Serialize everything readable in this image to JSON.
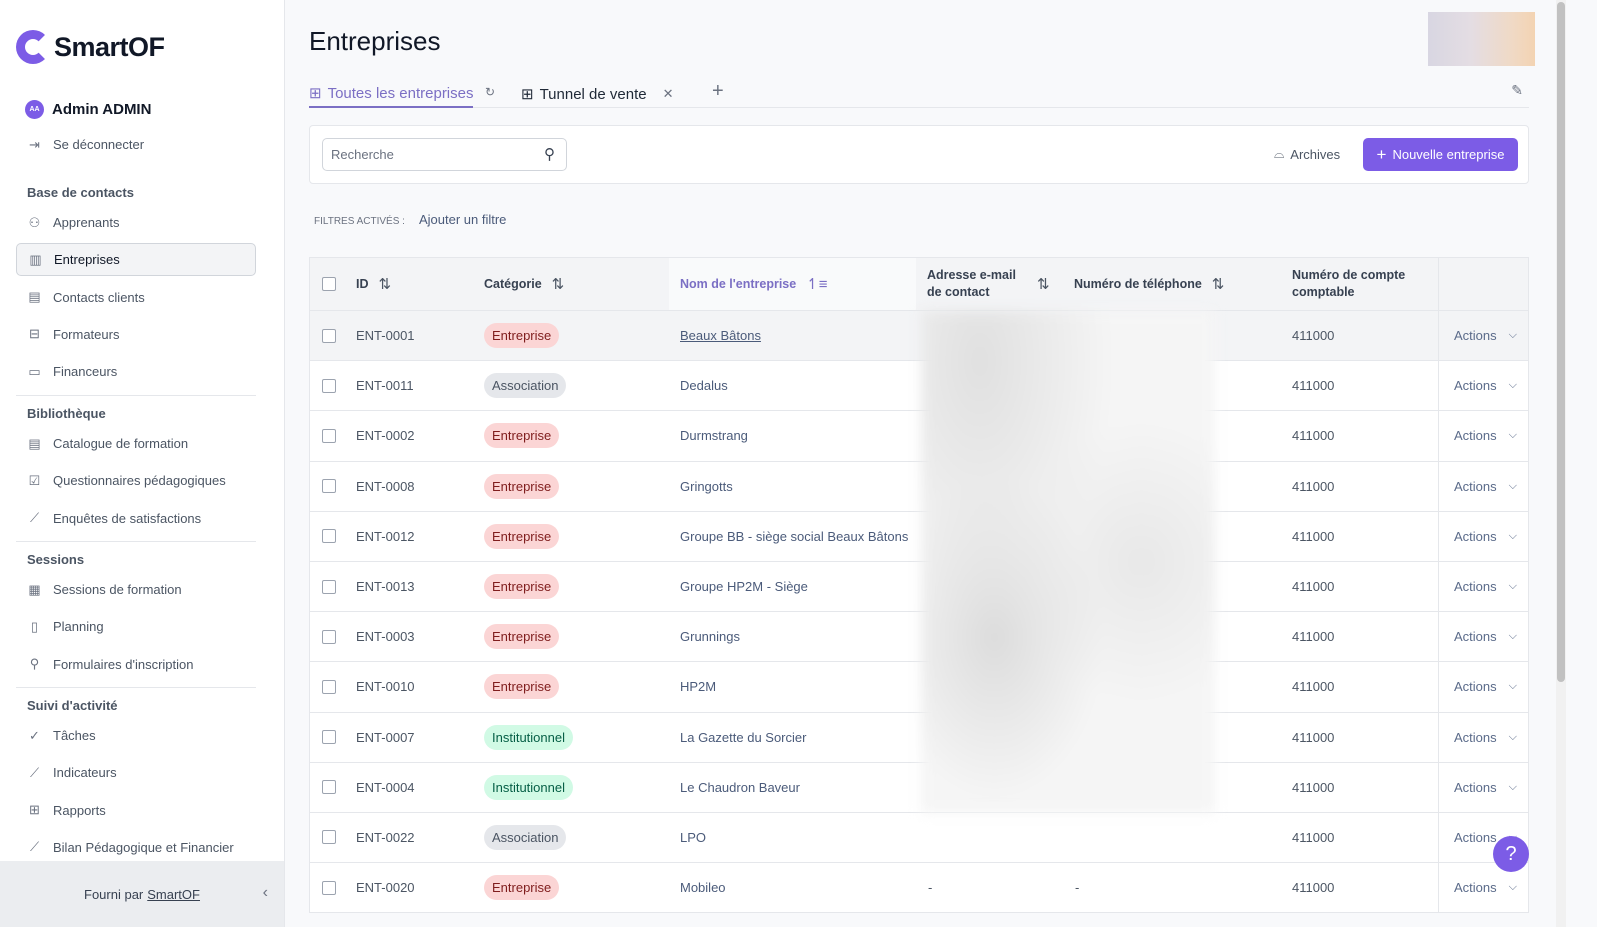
{
  "brand": {
    "name": "SmartOF",
    "accent": "#7c5ce6"
  },
  "user": {
    "initials": "AA",
    "name": "Admin ADMIN",
    "logout": "Se déconnecter"
  },
  "sidebar": {
    "sections": [
      {
        "title": "Base de contacts",
        "items": [
          {
            "label": "Apprenants",
            "icon": "users-icon"
          },
          {
            "label": "Entreprises",
            "icon": "building-icon",
            "active": true
          },
          {
            "label": "Contacts clients",
            "icon": "contact-card-icon"
          },
          {
            "label": "Formateurs",
            "icon": "briefcase-icon"
          },
          {
            "label": "Financeurs",
            "icon": "credit-card-icon"
          }
        ]
      },
      {
        "title": "Bibliothèque",
        "items": [
          {
            "label": "Catalogue de formation",
            "icon": "book-icon"
          },
          {
            "label": "Questionnaires pédagogiques",
            "icon": "checkbox-icon"
          },
          {
            "label": "Enquêtes de satisfactions",
            "icon": "chart-line-icon"
          }
        ]
      },
      {
        "title": "Sessions",
        "items": [
          {
            "label": "Sessions de formation",
            "icon": "calendar-icon"
          },
          {
            "label": "Planning",
            "icon": "map-icon"
          },
          {
            "label": "Formulaires d'inscription",
            "icon": "user-plus-icon"
          }
        ]
      },
      {
        "title": "Suivi d'activité",
        "items": [
          {
            "label": "Tâches",
            "icon": "check-circle-icon"
          },
          {
            "label": "Indicateurs",
            "icon": "chart-line-icon"
          },
          {
            "label": "Rapports",
            "icon": "table-icon"
          },
          {
            "label": "Bilan Pédagogique et Financier",
            "icon": "chart-line-icon"
          }
        ]
      }
    ],
    "footer_prefix": "Fourni par",
    "footer_link": "SmartOF"
  },
  "page": {
    "title": "Entreprises"
  },
  "tabs": [
    {
      "label": "Toutes les entreprises",
      "active": true
    },
    {
      "label": "Tunnel de vente"
    }
  ],
  "toolbar": {
    "search_placeholder": "Recherche",
    "archives": "Archives",
    "new_button": "Nouvelle entreprise"
  },
  "filters": {
    "label": "FILTRES ACTIVÉS :",
    "add": "Ajouter un filtre"
  },
  "table": {
    "columns": [
      "ID",
      "Catégorie",
      "Nom de l'entreprise",
      "Adresse e-mail de contact",
      "Numéro de téléphone",
      "Numéro de compte comptable"
    ],
    "action_label": "Actions",
    "rows": [
      {
        "id": "ENT-0001",
        "cat": "Entreprise",
        "name": "Beaux Bâtons",
        "email": "",
        "phone": "",
        "account": "411000"
      },
      {
        "id": "ENT-0011",
        "cat": "Association",
        "name": "Dedalus",
        "email": "",
        "phone": "",
        "account": "411000"
      },
      {
        "id": "ENT-0002",
        "cat": "Entreprise",
        "name": "Durmstrang",
        "email": "",
        "phone": "",
        "account": "411000"
      },
      {
        "id": "ENT-0008",
        "cat": "Entreprise",
        "name": "Gringotts",
        "email": "",
        "phone": "",
        "account": "411000"
      },
      {
        "id": "ENT-0012",
        "cat": "Entreprise",
        "name": "Groupe BB - siège social Beaux Bâtons",
        "email": "",
        "phone": "",
        "account": "411000"
      },
      {
        "id": "ENT-0013",
        "cat": "Entreprise",
        "name": "Groupe HP2M - Siège",
        "email": "",
        "phone": "",
        "account": "411000"
      },
      {
        "id": "ENT-0003",
        "cat": "Entreprise",
        "name": "Grunnings",
        "email": "",
        "phone": "",
        "account": "411000"
      },
      {
        "id": "ENT-0010",
        "cat": "Entreprise",
        "name": "HP2M",
        "email": "",
        "phone": "",
        "account": "411000"
      },
      {
        "id": "ENT-0007",
        "cat": "Institutionnel",
        "name": "La Gazette du Sorcier",
        "email": "",
        "phone": "",
        "account": "411000"
      },
      {
        "id": "ENT-0004",
        "cat": "Institutionnel",
        "name": "Le Chaudron Baveur",
        "email": "",
        "phone": "",
        "account": "411000"
      },
      {
        "id": "ENT-0022",
        "cat": "Association",
        "name": "LPO",
        "email": "",
        "phone": "",
        "account": "411000"
      },
      {
        "id": "ENT-0020",
        "cat": "Entreprise",
        "name": "Mobileo",
        "email": "-",
        "phone": "-",
        "account": "411000"
      }
    ]
  },
  "help": "?"
}
